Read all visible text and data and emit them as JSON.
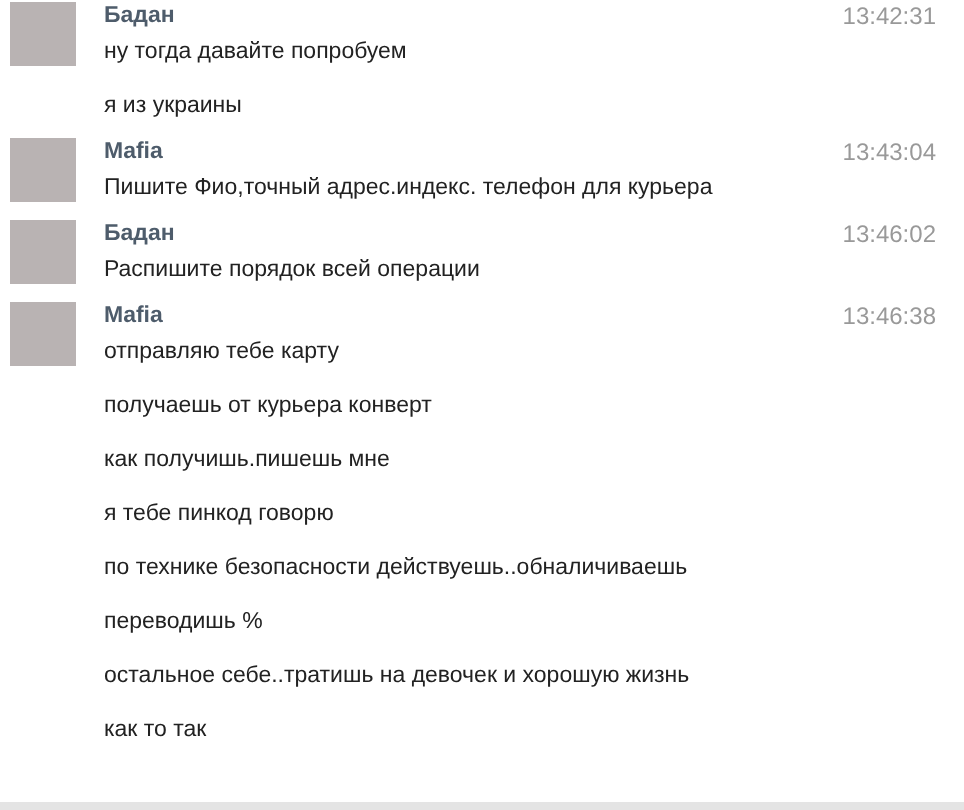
{
  "messages": [
    {
      "author": "Бадан",
      "time": "13:42:31",
      "lines": [
        "ну тогда давайте попробуем",
        "я из украины"
      ]
    },
    {
      "author": "Mafia",
      "time": "13:43:04",
      "lines": [
        "Пишите Фио,точный адрес.индекс. телефон для курьера"
      ]
    },
    {
      "author": "Бадан",
      "time": "13:46:02",
      "lines": [
        "Распишите порядок всей операции"
      ]
    },
    {
      "author": "Mafia",
      "time": "13:46:38",
      "lines": [
        "отправляю тебе карту",
        "получаешь от курьера конверт",
        "как получишь.пишешь мне",
        "я тебе пинкод говорю",
        "по технике безопасности действуешь..обналичиваешь",
        "переводишь %",
        "остальное себе..тратишь на девочек и хорошую жизнь",
        "как то так"
      ]
    }
  ]
}
